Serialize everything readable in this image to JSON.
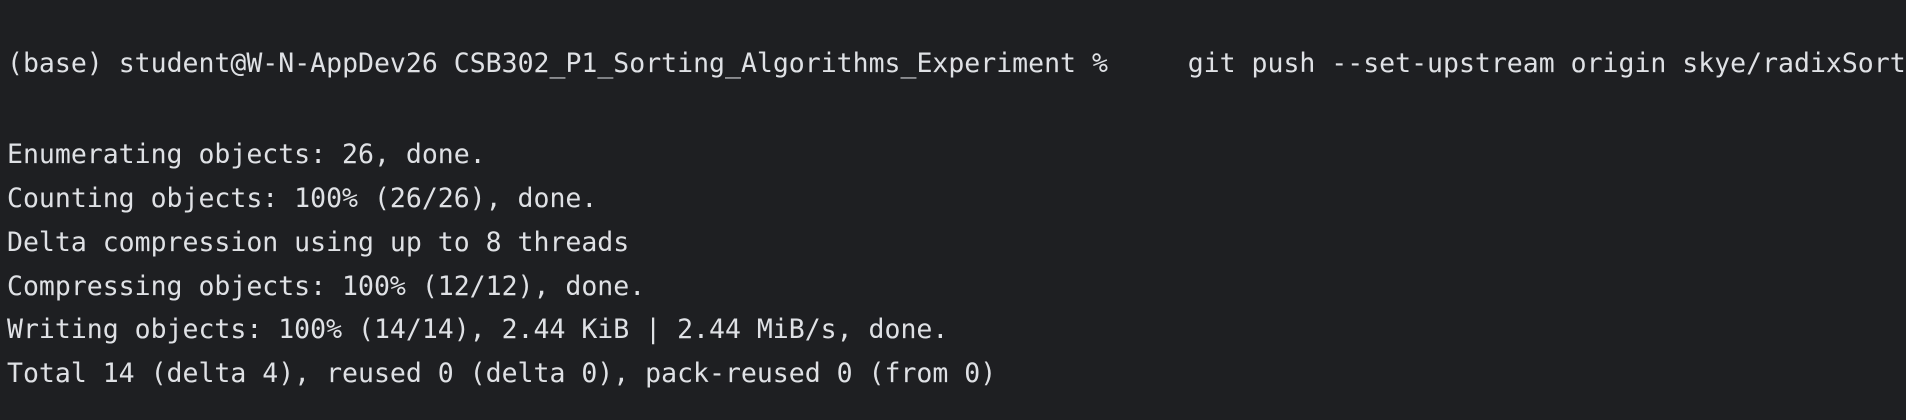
{
  "prompt": {
    "env": "(base)",
    "user_host": "student@W-N-AppDev26",
    "cwd": "CSB302_P1_Sorting_Algorithms_Experiment",
    "symbol": "%",
    "command": "git push --set-upstream origin skye/radixSort"
  },
  "output": [
    "Enumerating objects: 26, done.",
    "Counting objects: 100% (26/26), done.",
    "Delta compression using up to 8 threads",
    "Compressing objects: 100% (12/12), done.",
    "Writing objects: 100% (14/14), 2.44 KiB | 2.44 MiB/s, done.",
    "Total 14 (delta 4), reused 0 (delta 0), pack-reused 0 (from 0)"
  ],
  "colors": {
    "background": "#1e1f22",
    "text": "#dfe1e5"
  }
}
